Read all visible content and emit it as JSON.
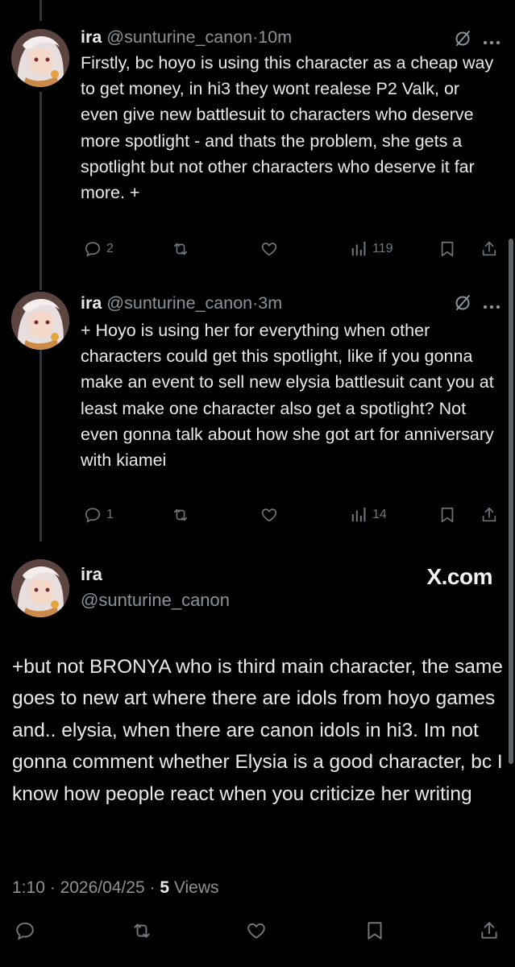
{
  "tweets": [
    {
      "name": "ira",
      "handle": "@sunturine_canon",
      "sep": "·",
      "time": "10m",
      "text": "Firstly, bc hoyo is using this character as a cheap way to get money, in hi3 they wont realese P2 Valk, or even give new battlesuit to characters who deserve more spotlight - and thats the problem, she gets a spotlight but not other characters who deserve it far more. +",
      "replies": "2",
      "views": "119"
    },
    {
      "name": "ira",
      "handle": "@sunturine_canon",
      "sep": "·",
      "time": "3m",
      "text": "+ Hoyo is using her for everything when other characters could get this spotlight, like if you gonna make an event to sell new elysia battlesuit cant you at least make one character also get a spotlight? Not even gonna talk about how she got art for anniversary with kiamei",
      "replies": "1",
      "views": "14"
    }
  ],
  "main_tweet": {
    "name": "ira",
    "handle": "@sunturine_canon",
    "brand": "X.com",
    "text": "+but not BRONYA who is third main character, the same goes to new art where there are idols from hoyo games and.. elysia, when there are canon idols in hi3. Im not gonna comment whether Elysia is a good character, bc I know how people react when you criticize her writing",
    "time": "1:10",
    "date": "2026/04/25",
    "sep": "·",
    "views_count": "5",
    "views_label": "Views"
  },
  "icons": {
    "reply": "reply-icon",
    "retweet": "retweet-icon",
    "like": "heart-icon",
    "views": "views-bar-chart-icon",
    "bookmark": "bookmark-icon",
    "share": "share-icon",
    "grok": "grok-icon",
    "more": "more-options-icon"
  },
  "colors": {
    "background": "#000000",
    "text": "#e7e9ea",
    "secondary": "#8b9299",
    "thread_line": "#333639"
  }
}
